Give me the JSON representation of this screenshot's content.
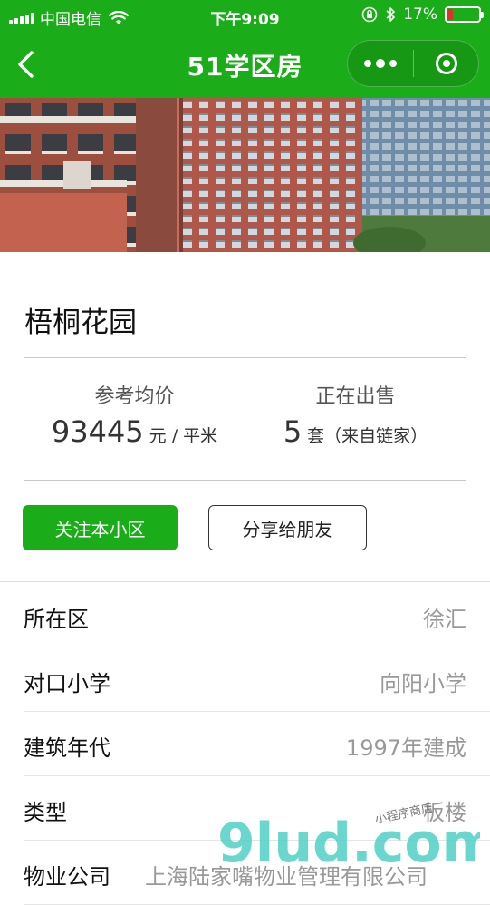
{
  "status_bar": {
    "carrier": "中国电信",
    "time": "下午9:09",
    "battery_percent": "17%",
    "battery_level": 0.17,
    "battery_color": "#e0302a"
  },
  "nav": {
    "title": "51学区房",
    "accent_color": "#1aad19"
  },
  "community": {
    "name": "梧桐花园"
  },
  "stats": {
    "avg_price": {
      "label": "参考均价",
      "value": "93445",
      "unit": "元 / 平米"
    },
    "on_sale": {
      "label": "正在出售",
      "value": "5",
      "unit": "套（来自链家）"
    }
  },
  "actions": {
    "follow_label": "关注本小区",
    "share_label": "分享给朋友"
  },
  "details": [
    {
      "label": "所在区",
      "value": "徐汇"
    },
    {
      "label": "对口小学",
      "value": "向阳小学"
    },
    {
      "label": "建筑年代",
      "value": "1997年建成"
    },
    {
      "label": "类型",
      "value": "板楼"
    },
    {
      "label": "物业公司",
      "value": "上海陆家嘴物业管理有限公司"
    }
  ],
  "watermark": {
    "brand": "9lud.com",
    "tagline": "小程序商店"
  }
}
